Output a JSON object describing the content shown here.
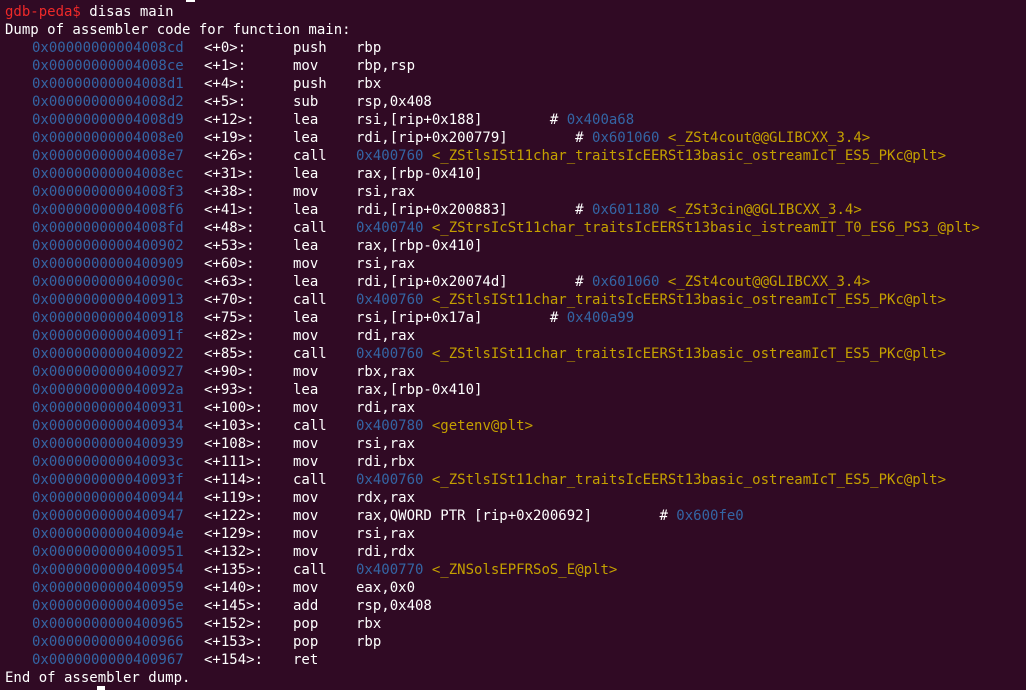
{
  "terminal": {
    "prompt": "gdb-peda$",
    "command": " disas main",
    "header": "Dump of assembler code for function main:",
    "footer": "End of assembler dump."
  },
  "colors": {
    "background": "#300a24",
    "prompt": "#ef2929",
    "address": "#3465a4",
    "symbol": "#c4a000",
    "text": "#ffffff"
  },
  "instructions": [
    {
      "addr": "0x00000000004008cd",
      "off": "<+0>:",
      "mn": "push",
      "ops": "rbp",
      "tgt": "",
      "sym": "",
      "cmt": "",
      "cmtsym": ""
    },
    {
      "addr": "0x00000000004008ce",
      "off": "<+1>:",
      "mn": "mov",
      "ops": "rbp,rsp",
      "tgt": "",
      "sym": "",
      "cmt": "",
      "cmtsym": ""
    },
    {
      "addr": "0x00000000004008d1",
      "off": "<+4>:",
      "mn": "push",
      "ops": "rbx",
      "tgt": "",
      "sym": "",
      "cmt": "",
      "cmtsym": ""
    },
    {
      "addr": "0x00000000004008d2",
      "off": "<+5>:",
      "mn": "sub",
      "ops": "rsp,0x408",
      "tgt": "",
      "sym": "",
      "cmt": "",
      "cmtsym": ""
    },
    {
      "addr": "0x00000000004008d9",
      "off": "<+12>:",
      "mn": "lea",
      "ops": "rsi,[rip+0x188]        ",
      "tgt": "",
      "sym": "",
      "cmt": "0x400a68",
      "cmtsym": ""
    },
    {
      "addr": "0x00000000004008e0",
      "off": "<+19>:",
      "mn": "lea",
      "ops": "rdi,[rip+0x200779]        ",
      "tgt": "",
      "sym": "",
      "cmt": "0x601060",
      "cmtsym": "<_ZSt4cout@@GLIBCXX_3.4>"
    },
    {
      "addr": "0x00000000004008e7",
      "off": "<+26>:",
      "mn": "call",
      "ops": "",
      "tgt": "0x400760",
      "sym": "<_ZStlsISt11char_traitsIcEERSt13basic_ostreamIcT_ES5_PKc@plt>",
      "cmt": "",
      "cmtsym": ""
    },
    {
      "addr": "0x00000000004008ec",
      "off": "<+31>:",
      "mn": "lea",
      "ops": "rax,[rbp-0x410]",
      "tgt": "",
      "sym": "",
      "cmt": "",
      "cmtsym": ""
    },
    {
      "addr": "0x00000000004008f3",
      "off": "<+38>:",
      "mn": "mov",
      "ops": "rsi,rax",
      "tgt": "",
      "sym": "",
      "cmt": "",
      "cmtsym": ""
    },
    {
      "addr": "0x00000000004008f6",
      "off": "<+41>:",
      "mn": "lea",
      "ops": "rdi,[rip+0x200883]        ",
      "tgt": "",
      "sym": "",
      "cmt": "0x601180",
      "cmtsym": "<_ZSt3cin@@GLIBCXX_3.4>"
    },
    {
      "addr": "0x00000000004008fd",
      "off": "<+48>:",
      "mn": "call",
      "ops": "",
      "tgt": "0x400740",
      "sym": "<_ZStrsIcSt11char_traitsIcEERSt13basic_istreamIT_T0_ES6_PS3_@plt>",
      "cmt": "",
      "cmtsym": ""
    },
    {
      "addr": "0x0000000000400902",
      "off": "<+53>:",
      "mn": "lea",
      "ops": "rax,[rbp-0x410]",
      "tgt": "",
      "sym": "",
      "cmt": "",
      "cmtsym": ""
    },
    {
      "addr": "0x0000000000400909",
      "off": "<+60>:",
      "mn": "mov",
      "ops": "rsi,rax",
      "tgt": "",
      "sym": "",
      "cmt": "",
      "cmtsym": ""
    },
    {
      "addr": "0x000000000040090c",
      "off": "<+63>:",
      "mn": "lea",
      "ops": "rdi,[rip+0x20074d]        ",
      "tgt": "",
      "sym": "",
      "cmt": "0x601060",
      "cmtsym": "<_ZSt4cout@@GLIBCXX_3.4>"
    },
    {
      "addr": "0x0000000000400913",
      "off": "<+70>:",
      "mn": "call",
      "ops": "",
      "tgt": "0x400760",
      "sym": "<_ZStlsISt11char_traitsIcEERSt13basic_ostreamIcT_ES5_PKc@plt>",
      "cmt": "",
      "cmtsym": ""
    },
    {
      "addr": "0x0000000000400918",
      "off": "<+75>:",
      "mn": "lea",
      "ops": "rsi,[rip+0x17a]        ",
      "tgt": "",
      "sym": "",
      "cmt": "0x400a99",
      "cmtsym": ""
    },
    {
      "addr": "0x000000000040091f",
      "off": "<+82>:",
      "mn": "mov",
      "ops": "rdi,rax",
      "tgt": "",
      "sym": "",
      "cmt": "",
      "cmtsym": ""
    },
    {
      "addr": "0x0000000000400922",
      "off": "<+85>:",
      "mn": "call",
      "ops": "",
      "tgt": "0x400760",
      "sym": "<_ZStlsISt11char_traitsIcEERSt13basic_ostreamIcT_ES5_PKc@plt>",
      "cmt": "",
      "cmtsym": ""
    },
    {
      "addr": "0x0000000000400927",
      "off": "<+90>:",
      "mn": "mov",
      "ops": "rbx,rax",
      "tgt": "",
      "sym": "",
      "cmt": "",
      "cmtsym": ""
    },
    {
      "addr": "0x000000000040092a",
      "off": "<+93>:",
      "mn": "lea",
      "ops": "rax,[rbp-0x410]",
      "tgt": "",
      "sym": "",
      "cmt": "",
      "cmtsym": ""
    },
    {
      "addr": "0x0000000000400931",
      "off": "<+100>:",
      "mn": "mov",
      "ops": "rdi,rax",
      "tgt": "",
      "sym": "",
      "cmt": "",
      "cmtsym": ""
    },
    {
      "addr": "0x0000000000400934",
      "off": "<+103>:",
      "mn": "call",
      "ops": "",
      "tgt": "0x400780",
      "sym": "<getenv@plt>",
      "cmt": "",
      "cmtsym": ""
    },
    {
      "addr": "0x0000000000400939",
      "off": "<+108>:",
      "mn": "mov",
      "ops": "rsi,rax",
      "tgt": "",
      "sym": "",
      "cmt": "",
      "cmtsym": ""
    },
    {
      "addr": "0x000000000040093c",
      "off": "<+111>:",
      "mn": "mov",
      "ops": "rdi,rbx",
      "tgt": "",
      "sym": "",
      "cmt": "",
      "cmtsym": ""
    },
    {
      "addr": "0x000000000040093f",
      "off": "<+114>:",
      "mn": "call",
      "ops": "",
      "tgt": "0x400760",
      "sym": "<_ZStlsISt11char_traitsIcEERSt13basic_ostreamIcT_ES5_PKc@plt>",
      "cmt": "",
      "cmtsym": ""
    },
    {
      "addr": "0x0000000000400944",
      "off": "<+119>:",
      "mn": "mov",
      "ops": "rdx,rax",
      "tgt": "",
      "sym": "",
      "cmt": "",
      "cmtsym": ""
    },
    {
      "addr": "0x0000000000400947",
      "off": "<+122>:",
      "mn": "mov",
      "ops": "rax,QWORD PTR [rip+0x200692]        ",
      "tgt": "",
      "sym": "",
      "cmt": "0x600fe0",
      "cmtsym": ""
    },
    {
      "addr": "0x000000000040094e",
      "off": "<+129>:",
      "mn": "mov",
      "ops": "rsi,rax",
      "tgt": "",
      "sym": "",
      "cmt": "",
      "cmtsym": ""
    },
    {
      "addr": "0x0000000000400951",
      "off": "<+132>:",
      "mn": "mov",
      "ops": "rdi,rdx",
      "tgt": "",
      "sym": "",
      "cmt": "",
      "cmtsym": ""
    },
    {
      "addr": "0x0000000000400954",
      "off": "<+135>:",
      "mn": "call",
      "ops": "",
      "tgt": "0x400770",
      "sym": "<_ZNSolsEPFRSoS_E@plt>",
      "cmt": "",
      "cmtsym": ""
    },
    {
      "addr": "0x0000000000400959",
      "off": "<+140>:",
      "mn": "mov",
      "ops": "eax,0x0",
      "tgt": "",
      "sym": "",
      "cmt": "",
      "cmtsym": ""
    },
    {
      "addr": "0x000000000040095e",
      "off": "<+145>:",
      "mn": "add",
      "ops": "rsp,0x408",
      "tgt": "",
      "sym": "",
      "cmt": "",
      "cmtsym": ""
    },
    {
      "addr": "0x0000000000400965",
      "off": "<+152>:",
      "mn": "pop",
      "ops": "rbx",
      "tgt": "",
      "sym": "",
      "cmt": "",
      "cmtsym": ""
    },
    {
      "addr": "0x0000000000400966",
      "off": "<+153>:",
      "mn": "pop",
      "ops": "rbp",
      "tgt": "",
      "sym": "",
      "cmt": "",
      "cmtsym": ""
    },
    {
      "addr": "0x0000000000400967",
      "off": "<+154>:",
      "mn": "ret",
      "ops": "",
      "tgt": "",
      "sym": "",
      "cmt": "",
      "cmtsym": ""
    }
  ]
}
